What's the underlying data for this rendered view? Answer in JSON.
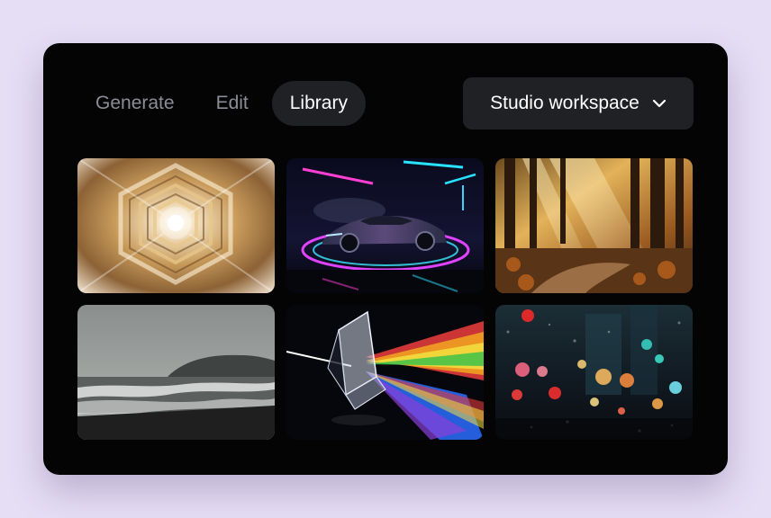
{
  "tabs": [
    {
      "label": "Generate",
      "active": false
    },
    {
      "label": "Edit",
      "active": false
    },
    {
      "label": "Library",
      "active": true
    }
  ],
  "workspace": {
    "label": "Studio workspace",
    "icon": "chevron-down-icon"
  },
  "gallery": [
    {
      "subject": "golden-tunnel"
    },
    {
      "subject": "neon-sports-car"
    },
    {
      "subject": "autumn-forest"
    },
    {
      "subject": "misty-beach"
    },
    {
      "subject": "prism-rainbow"
    },
    {
      "subject": "rainy-city-bokeh"
    }
  ],
  "colors": {
    "page_background": "#e6def5",
    "panel_background": "#040405",
    "active_pill": "#202125",
    "inactive_tab_text": "#8b8d96",
    "active_text": "#ffffff"
  }
}
